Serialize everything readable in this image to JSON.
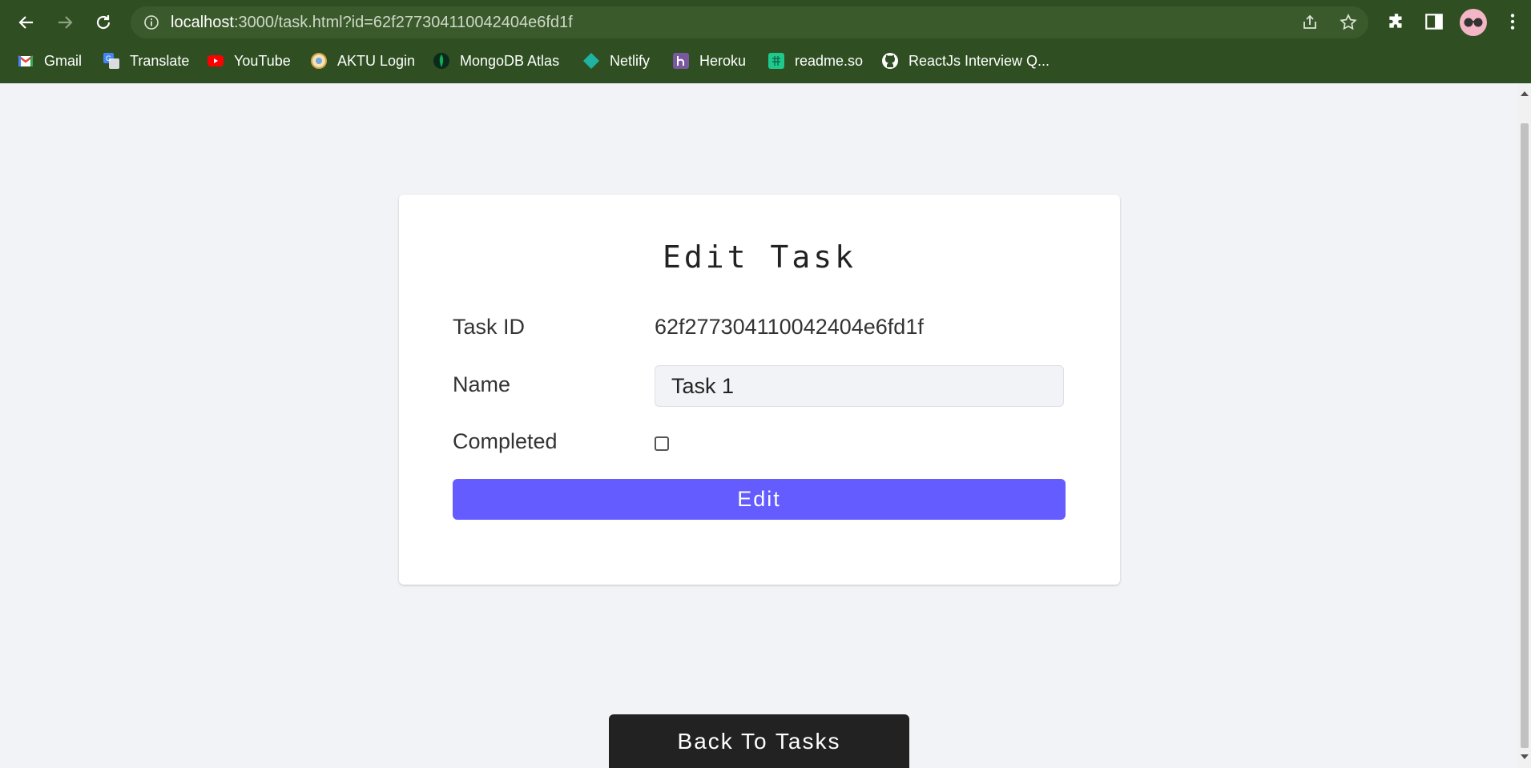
{
  "browser": {
    "url_host": "localhost",
    "url_rest": ":3000/task.html?id=62f277304110042404e6fd1f",
    "bookmarks": [
      {
        "label": "Gmail",
        "icon": "gmail-icon",
        "color": "#ea4335"
      },
      {
        "label": "Translate",
        "icon": "translate-icon",
        "color": "#4285f4"
      },
      {
        "label": "YouTube",
        "icon": "youtube-icon",
        "color": "#ff0000"
      },
      {
        "label": "AKTU Login",
        "icon": "aktu-icon",
        "color": "#d9a441"
      },
      {
        "label": "MongoDB Atlas",
        "icon": "mongodb-icon",
        "color": "#13aa52"
      },
      {
        "label": "Netlify",
        "icon": "netlify-icon",
        "color": "#20b3a4"
      },
      {
        "label": "Heroku",
        "icon": "heroku-icon",
        "color": "#79589f"
      },
      {
        "label": "readme.so",
        "icon": "readme-icon",
        "color": "#1ec98e"
      },
      {
        "label": "ReactJs Interview Q...",
        "icon": "github-icon",
        "color": "#ffffff"
      }
    ]
  },
  "card": {
    "title": "Edit Task",
    "task_id_label": "Task ID",
    "task_id_value": "62f277304110042404e6fd1f",
    "name_label": "Name",
    "name_value": "Task 1",
    "completed_label": "Completed",
    "completed": false,
    "edit_button": "Edit"
  },
  "back_button": "Back To Tasks",
  "colors": {
    "accent": "#645cff",
    "chrome": "#2f4f22",
    "dark_button": "#222222"
  }
}
